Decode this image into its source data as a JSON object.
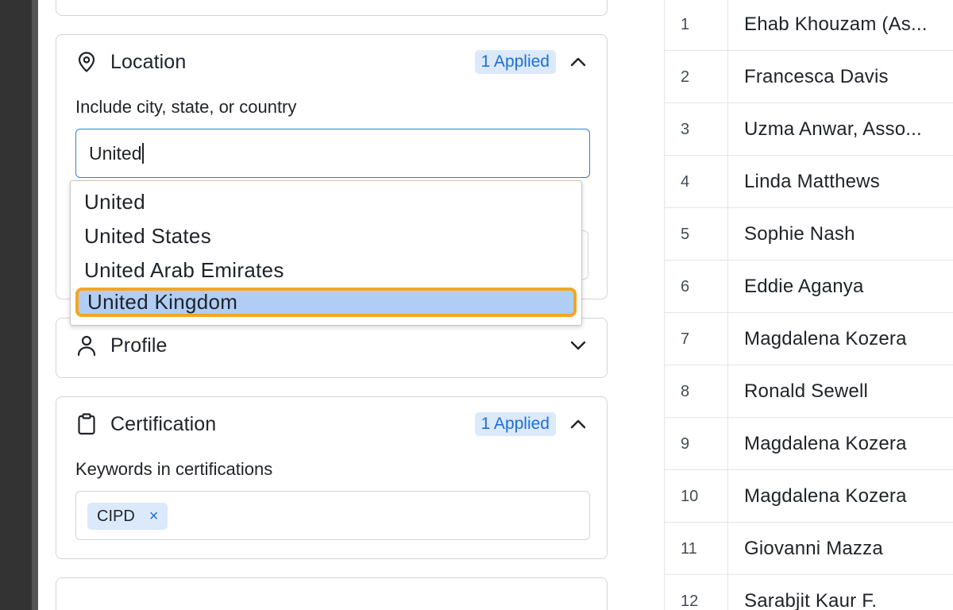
{
  "location_section": {
    "title": "Location",
    "badge": "1 Applied",
    "field_label": "Include city, state, or country",
    "input_value": "United",
    "suggestions": [
      "United",
      "United States",
      "United Arab Emirates",
      "United Kingdom"
    ],
    "highlighted_suggestion": "United Kingdom"
  },
  "profile_section": {
    "title": "Profile"
  },
  "certification_section": {
    "title": "Certification",
    "badge": "1 Applied",
    "field_label": "Keywords in certifications",
    "chips": [
      {
        "label": "CIPD",
        "remove": "×"
      }
    ]
  },
  "results_table": {
    "rows": [
      {
        "num": "1",
        "name": "Ehab Khouzam (As..."
      },
      {
        "num": "2",
        "name": "Francesca Davis"
      },
      {
        "num": "3",
        "name": "Uzma Anwar, Asso..."
      },
      {
        "num": "4",
        "name": "Linda Matthews"
      },
      {
        "num": "5",
        "name": "Sophie Nash"
      },
      {
        "num": "6",
        "name": "Eddie Aganya"
      },
      {
        "num": "7",
        "name": "Magdalena Kozera"
      },
      {
        "num": "8",
        "name": "Ronald Sewell"
      },
      {
        "num": "9",
        "name": "Magdalena Kozera"
      },
      {
        "num": "10",
        "name": "Magdalena Kozera"
      },
      {
        "num": "11",
        "name": "Giovanni Mazza"
      },
      {
        "num": "12",
        "name": "Sarabjit Kaur F."
      }
    ]
  },
  "colors": {
    "accent": "#1d6fd6",
    "badge_bg": "#dbe9fb",
    "selection_bg": "#b0cef5",
    "highlight_outline": "#f5a623",
    "border": "#d0d4da",
    "left_rail": "#333333"
  },
  "icons": {
    "location": "map-pin-icon",
    "profile": "user-icon",
    "certification": "clipboard-icon",
    "expanded": "chevron-up-icon",
    "collapsed": "chevron-down-icon",
    "remove_chip": "close-icon"
  }
}
